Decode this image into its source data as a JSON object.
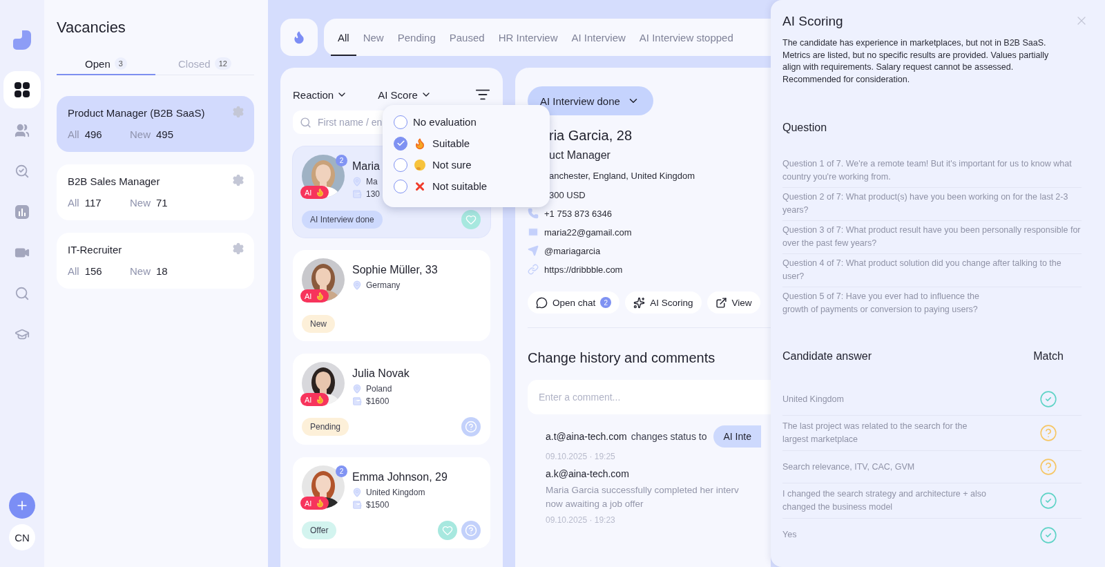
{
  "sidebar": {
    "nav_items": [
      {
        "selected": true
      },
      {
        "selected": false
      },
      {
        "selected": false
      },
      {
        "selected": false
      },
      {
        "selected": false
      },
      {
        "selected": false
      },
      {
        "selected": false
      }
    ],
    "user_initials": "CN"
  },
  "vacancies": {
    "title": "Vacancies",
    "tabs": [
      {
        "label": "Open",
        "count": "3",
        "selected": true
      },
      {
        "label": "Closed",
        "count": "12",
        "selected": false
      }
    ],
    "items": [
      {
        "title": "Product Manager (B2B SaaS)",
        "all_label": "All",
        "all": "496",
        "new_label": "New",
        "new": "495",
        "selected": true
      },
      {
        "title": "B2B Sales Manager",
        "all_label": "All",
        "all": "117",
        "new_label": "New",
        "new": "71",
        "selected": false
      },
      {
        "title": "IT-Recruiter",
        "all_label": "All",
        "all": "156",
        "new_label": "New",
        "new": "18",
        "selected": false
      }
    ]
  },
  "status_tabs": [
    {
      "label": "All",
      "selected": true
    },
    {
      "label": "New",
      "selected": false
    },
    {
      "label": "Pending",
      "selected": false
    },
    {
      "label": "Paused",
      "selected": false
    },
    {
      "label": "HR Interview",
      "selected": false
    },
    {
      "label": "AI Interview",
      "selected": false
    },
    {
      "label": "AI Interview stopped",
      "selected": false
    }
  ],
  "candidates": {
    "filters": [
      {
        "label": "Reaction"
      },
      {
        "label": "AI Score"
      }
    ],
    "search": {
      "placeholder": "First name / en"
    },
    "score_menu": {
      "options": [
        {
          "label": "No evaluation",
          "kind": "none",
          "checked": false
        },
        {
          "label": "Suitable",
          "kind": "suitable",
          "checked": true
        },
        {
          "label": "Not sure",
          "kind": "unsure",
          "checked": false
        },
        {
          "label": "Not suitable",
          "kind": "unsuitable",
          "checked": false
        }
      ]
    },
    "items": [
      {
        "name": "Maria",
        "unread": "2",
        "location": "Ma",
        "salary": "130",
        "ai_badge": "AI",
        "status": {
          "label": "AI Interview done",
          "color": "#cdd9fd"
        },
        "actions": [
          {
            "kind": "heart"
          }
        ],
        "selected": true
      },
      {
        "name": "Sophie Müller, 33",
        "location": "Germany",
        "ai_badge": "AI",
        "status": {
          "label": "New",
          "color": "#fdf0d9"
        },
        "selected": false
      },
      {
        "name": "Julia Novak",
        "location": "Poland",
        "salary": "$1600",
        "ai_badge": "AI",
        "status": {
          "label": "Pending",
          "color": "#fdf0d9"
        },
        "actions": [
          {
            "kind": "question"
          }
        ],
        "selected": false
      },
      {
        "name": "Emma Johnson, 29",
        "unread": "2",
        "location": "United Kingdom",
        "salary": "$1500",
        "ai_badge": "AI",
        "status": {
          "label": "Offer",
          "color": "#d3f4ef"
        },
        "actions": [
          {
            "kind": "heart"
          },
          {
            "kind": "question"
          }
        ],
        "selected": false
      }
    ]
  },
  "detail": {
    "status": "AI Interview done",
    "name": "ria Garcia, 28",
    "role": "uct Manager",
    "location": "anchester, England, United Kingdom",
    "salary": "300 USD",
    "contacts": [
      {
        "kind": "phone",
        "value": "+1 753 873 6346"
      },
      {
        "kind": "email",
        "value": "maria22@gamail.com"
      },
      {
        "kind": "telegram",
        "value": "@mariagarcia"
      },
      {
        "kind": "link",
        "value": "https://dribbble.com"
      }
    ],
    "actions": [
      {
        "kind": "chat",
        "label": "Open chat",
        "count": "2"
      },
      {
        "kind": "scoring",
        "label": "AI Scoring"
      },
      {
        "kind": "view",
        "label": "View"
      }
    ],
    "history_title": "Change history and comments",
    "comment": {
      "placeholder": "Enter a comment..."
    },
    "history": [
      {
        "kind": "status",
        "author": "a.t@aina-tech.com",
        "text": "changes status to",
        "status": "AI Inte",
        "time": "09.10.2025 · 19:25"
      },
      {
        "kind": "comment",
        "author": "a.k@aina-tech.com",
        "text": "Maria Garcia successfully completed her interv\nnow awaiting a job offer",
        "time": "09.10.2025 · 19:23"
      }
    ]
  },
  "ai_scoring": {
    "title": "AI Scoring",
    "summary": "The candidate has experience in marketplaces, but not in B2B SaaS. Metrics are listed, but no specific results are provided. Values partially align with requirements. Salary request cannot be assessed. Recommended for consideration.",
    "question_title": "Question",
    "questions": [
      "Question 1 of 7. We're a remote team! But it's important for us to know what country you're working from.",
      "Question 2 of 7: What product(s) have you been working on for the last 2-3 years?",
      "Question 3 of 7: What product result have you been personally responsible for over the past few years?",
      "Question 4 of 7: What product solution did you change after talking to the user?",
      "Question 5 of 7: Have you ever had to influence the\ngrowth of payments or conversion to paying users?"
    ],
    "answer_title": "Candidate answer",
    "match_title": "Match",
    "answers": [
      {
        "text": "United Kingdom",
        "matched": true
      },
      {
        "text": "The last project was related to the search for the largest marketplace",
        "matched": false
      },
      {
        "text": "Search relevance, ITV, CAC, GVM",
        "matched": false
      },
      {
        "text": "I changed the search strategy and architecture + also changed the business model",
        "matched": true
      },
      {
        "text": "Yes",
        "matched": true
      }
    ]
  }
}
